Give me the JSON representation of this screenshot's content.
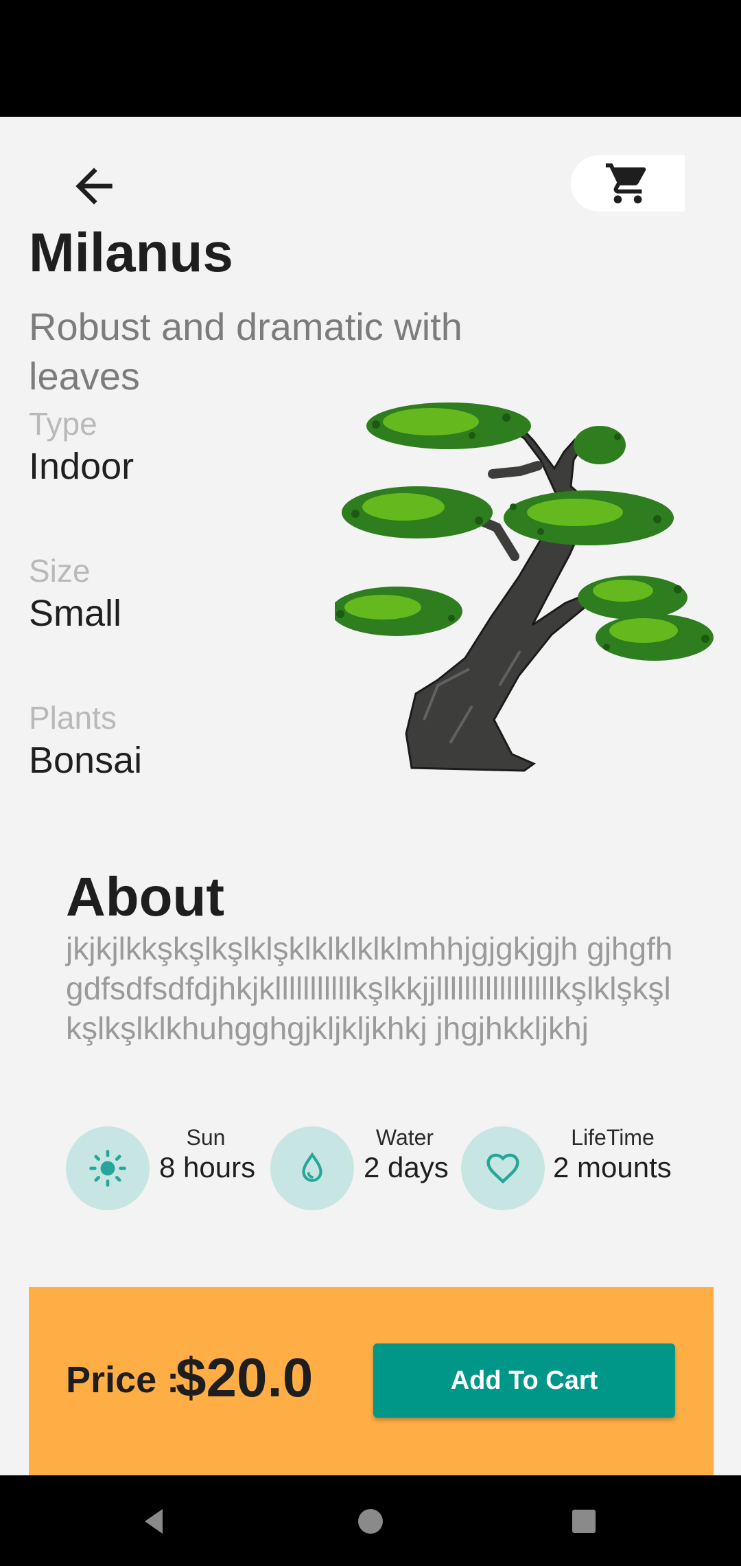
{
  "header": {
    "back_icon": "arrow-left-icon",
    "cart_icon": "shopping-cart-icon"
  },
  "product": {
    "name": "Milanus",
    "description": "Robust and dramatic with leaves",
    "image_icon": "bonsai-tree-illustration",
    "specs": [
      {
        "label": "Type",
        "value": "Indoor"
      },
      {
        "label": "Size",
        "value": "Small"
      },
      {
        "label": "Plants",
        "value": "Bonsai"
      }
    ]
  },
  "about": {
    "title": "About",
    "text": "jkjkjlkkşkşlkşlklşklklklklklmhhjgjgkjgjh gjhgfhgdfsdfsdfdjhkjklllllllllllkşlkkjjlllllllllllllllllkşlklşkşlkşlkşlklkhuhgghgjkljkljkhkj jhgjhkkljkhj"
  },
  "care": [
    {
      "label": "Sun",
      "value": "8 hours",
      "icon": "sun-icon"
    },
    {
      "label": "Water",
      "value": "2 days",
      "icon": "water-drop-icon"
    },
    {
      "label": "LifeTime",
      "value": "2 mounts",
      "icon": "heart-icon"
    }
  ],
  "footer": {
    "price_label": "Price :",
    "price_value": "$20.0",
    "add_to_cart_label": "Add To Cart"
  },
  "nav": {
    "back_icon": "nav-back-icon",
    "home_icon": "nav-home-icon",
    "recents_icon": "nav-recents-icon"
  },
  "colors": {
    "background": "#f3f3f3",
    "accent": "#009688",
    "price_panel": "#ffae45",
    "icon_circle": "#c7e6e3"
  }
}
